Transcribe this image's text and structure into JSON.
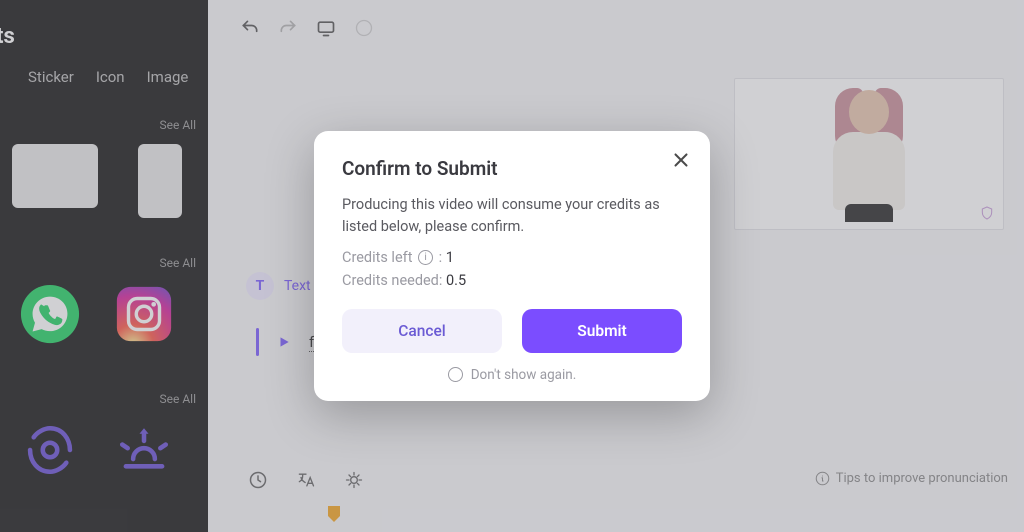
{
  "sidebar": {
    "title_fragment": "ts",
    "tabs": [
      "Sticker",
      "Icon",
      "Image"
    ],
    "see_all": "See All",
    "icons": {
      "whatsapp": "whatsapp-icon",
      "instagram": "instagram-icon",
      "hurricane": "hurricane-icon",
      "sunset": "sunset-icon"
    }
  },
  "topbar": {
    "undo": "undo",
    "redo": "redo",
    "device": "device"
  },
  "script": {
    "tab_label": "Text Script",
    "tab_letter": "T",
    "line_text": "for more d"
  },
  "footer": {
    "tips": "Tips to improve pronunciation"
  },
  "modal": {
    "title": "Confirm to Submit",
    "description": "Producing this video will consume your credits as listed below, please confirm.",
    "credits_left_label": "Credits left",
    "credits_left_value": "1",
    "credits_needed_label": "Credits needed:",
    "credits_needed_value": "0.5",
    "cancel": "Cancel",
    "submit": "Submit",
    "dont_show": "Don't show again."
  }
}
